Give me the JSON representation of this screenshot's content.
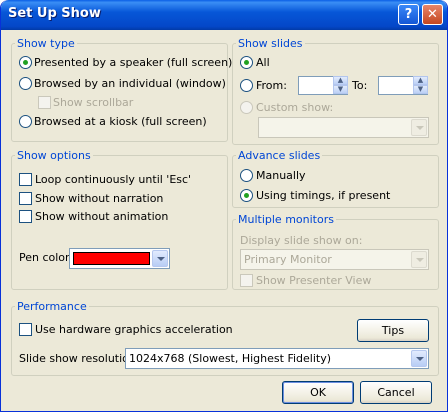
{
  "window": {
    "title": "Set Up Show",
    "help_label": "?",
    "close_label": "✕"
  },
  "show_type": {
    "legend": "Show type",
    "presented": "Presented by a speaker (full screen)",
    "browsed_individual": "Browsed by an individual (window)",
    "show_scrollbar": "Show scrollbar",
    "browsed_kiosk": "Browsed at a kiosk (full screen)"
  },
  "show_slides": {
    "legend": "Show slides",
    "all": "All",
    "from": "From:",
    "to": "To:",
    "custom_show": "Custom show:"
  },
  "show_options": {
    "legend": "Show options",
    "loop": "Loop continuously until 'Esc'",
    "no_narration": "Show without narration",
    "no_animation": "Show without animation",
    "pen_color": "Pen color:",
    "pen_color_value": "#ff0000"
  },
  "advance_slides": {
    "legend": "Advance slides",
    "manually": "Manually",
    "timings": "Using timings, if present"
  },
  "multiple_monitors": {
    "legend": "Multiple monitors",
    "display_on": "Display slide show on:",
    "monitor_value": "Primary Monitor",
    "presenter_view": "Show Presenter View"
  },
  "performance": {
    "legend": "Performance",
    "hw_accel": "Use hardware graphics acceleration",
    "tips": "Tips",
    "resolution_label": "Slide show resolution:",
    "resolution_value": "1024x768 (Slowest, Highest Fidelity)"
  },
  "buttons": {
    "ok": "OK",
    "cancel": "Cancel"
  }
}
